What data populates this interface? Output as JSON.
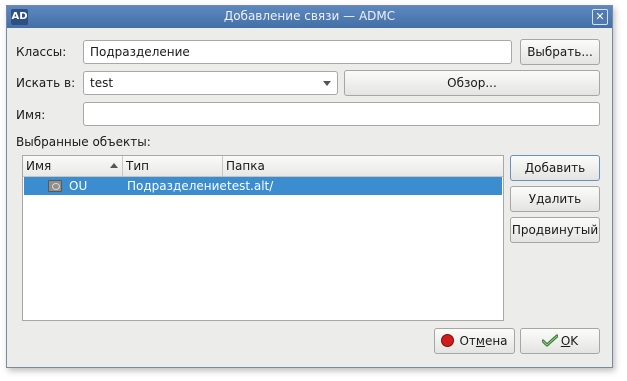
{
  "window": {
    "title": "Добавление связи — ADMC",
    "app_icon_text": "AD",
    "close_symbol": "✕"
  },
  "form": {
    "classes_label": "Классы:",
    "classes_value": "Подразделение",
    "select_button": "Выбрать...",
    "search_in_label": "Искать в:",
    "search_in_value": "test",
    "browse_button": "Обзор...",
    "name_label": "Имя:",
    "name_value": ""
  },
  "selected": {
    "label": "Выбранные объекты:",
    "columns": [
      "Имя",
      "Тип",
      "Папка"
    ],
    "rows": [
      {
        "name": "OU",
        "type": "Подразделение",
        "folder": "test.alt/",
        "icon": "ou-icon"
      }
    ]
  },
  "side_buttons": {
    "add": "Добавить",
    "remove": "Удалить",
    "advanced": "Продвинутый"
  },
  "footer": {
    "cancel_prefix": "От",
    "cancel_underlined": "м",
    "cancel_suffix": "ена",
    "ok_underlined": "O",
    "ok_suffix": "K"
  },
  "colors": {
    "titlebar": "#4f79b1",
    "selection": "#3b8dd0",
    "cancel_icon": "#d21b1b"
  }
}
